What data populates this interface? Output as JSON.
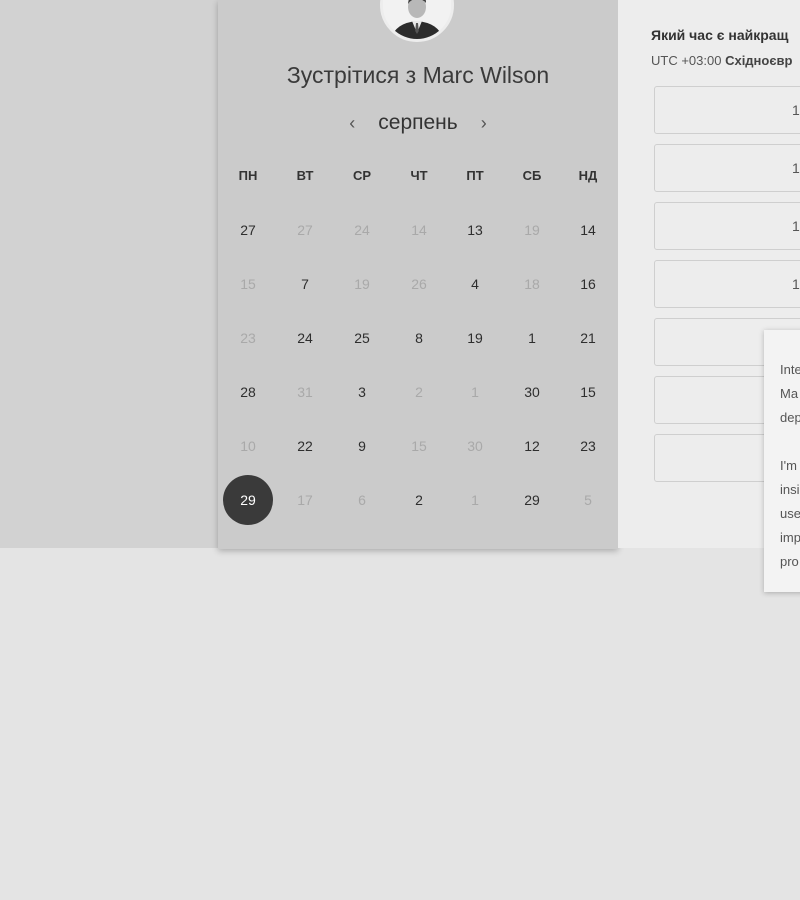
{
  "booking": {
    "title_prefix": "Зустрітися з",
    "host_name": "Marc Wilson"
  },
  "calendar": {
    "month": "серпень",
    "weekdays": [
      "ПН",
      "ВТ",
      "СР",
      "ЧТ",
      "ПТ",
      "СБ",
      "НД"
    ],
    "weeks": [
      [
        {
          "d": "27",
          "on": true
        },
        {
          "d": "27",
          "on": false
        },
        {
          "d": "24",
          "on": false
        },
        {
          "d": "14",
          "on": false
        },
        {
          "d": "13",
          "on": true
        },
        {
          "d": "19",
          "on": false
        },
        {
          "d": "14",
          "on": true
        }
      ],
      [
        {
          "d": "15",
          "on": false
        },
        {
          "d": "7",
          "on": true
        },
        {
          "d": "19",
          "on": false
        },
        {
          "d": "26",
          "on": false
        },
        {
          "d": "4",
          "on": true
        },
        {
          "d": "18",
          "on": false
        },
        {
          "d": "16",
          "on": true
        }
      ],
      [
        {
          "d": "23",
          "on": false
        },
        {
          "d": "24",
          "on": true
        },
        {
          "d": "25",
          "on": true
        },
        {
          "d": "8",
          "on": true
        },
        {
          "d": "19",
          "on": true
        },
        {
          "d": "1",
          "on": true
        },
        {
          "d": "21",
          "on": true
        }
      ],
      [
        {
          "d": "28",
          "on": true
        },
        {
          "d": "31",
          "on": false
        },
        {
          "d": "3",
          "on": true
        },
        {
          "d": "2",
          "on": false
        },
        {
          "d": "1",
          "on": false
        },
        {
          "d": "30",
          "on": true
        },
        {
          "d": "15",
          "on": true
        }
      ],
      [
        {
          "d": "10",
          "on": false
        },
        {
          "d": "22",
          "on": true
        },
        {
          "d": "9",
          "on": true
        },
        {
          "d": "15",
          "on": false
        },
        {
          "d": "30",
          "on": false
        },
        {
          "d": "12",
          "on": true
        },
        {
          "d": "23",
          "on": true
        }
      ],
      [
        {
          "d": "29",
          "on": true,
          "selected": true
        },
        {
          "d": "17",
          "on": false
        },
        {
          "d": "6",
          "on": false
        },
        {
          "d": "2",
          "on": true
        },
        {
          "d": "1",
          "on": false
        },
        {
          "d": "29",
          "on": true
        },
        {
          "d": "5",
          "on": false
        }
      ]
    ]
  },
  "times": {
    "heading": "Який час є найкращ",
    "tz_offset": "UTC +03:00",
    "tz_name": "Східноєвр",
    "slots": [
      "1",
      "1",
      "1",
      "1",
      "",
      "",
      ""
    ]
  },
  "popover": {
    "lines": [
      "Inte",
      "Ma",
      "dep",
      "",
      "I'm",
      "insi",
      "use",
      "imp",
      "pro"
    ]
  },
  "colors": {
    "selected_day": "#3a3a3a",
    "panel_bg": "#cbcbcb"
  }
}
